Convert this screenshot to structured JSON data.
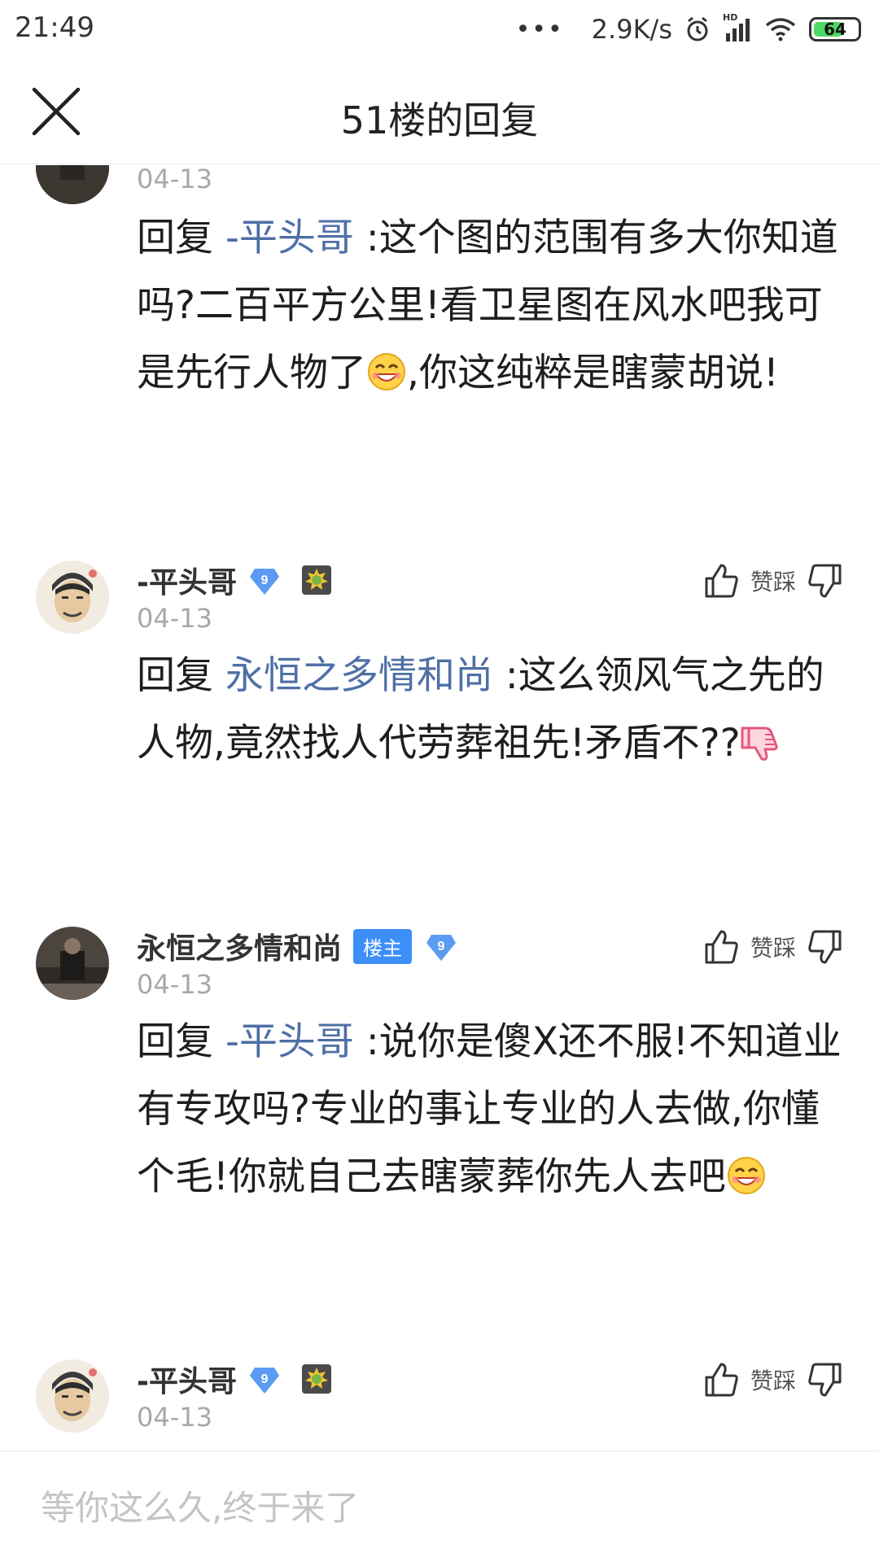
{
  "status_bar": {
    "time": "21:49",
    "dots": "•••",
    "speed": "2.9K/s",
    "hd_label": "HD",
    "battery": "64"
  },
  "header": {
    "title": "51楼的回复"
  },
  "replies": [
    {
      "username": "",
      "date": "04-13",
      "prefix": "回复",
      "mention": "-平头哥",
      "text": ":这个图的范围有多大你知道吗?二百平方公里!看卫星图在风水吧我可是先行人物了",
      "text_after": ",你这纯粹是瞎蒙胡说!",
      "emoji": "grin-emoji"
    },
    {
      "username": "-平头哥",
      "level": "9",
      "date": "04-13",
      "vote_label": "赞踩",
      "prefix": "回复",
      "mention": "永恒之多情和尚",
      "text": ":这么领风气之先的人物,竟然找人代劳葬祖先!矛盾不??",
      "emoji": "thumbs-down-emoji"
    },
    {
      "username": "永恒之多情和尚",
      "owner_badge": "楼主",
      "level": "9",
      "date": "04-13",
      "vote_label": "赞踩",
      "prefix": "回复",
      "mention": "-平头哥",
      "text": ":说你是傻X还不服!不知道业有专攻吗?专业的事让专业的人去做,你懂个毛!你就自己去瞎蒙葬你先人去吧",
      "emoji": "grin-emoji"
    },
    {
      "username": "-平头哥",
      "level": "9",
      "date": "04-13",
      "vote_label": "赞踩"
    }
  ],
  "input": {
    "placeholder": "等你这么久,终于来了"
  },
  "colors": {
    "mention": "#4f6fa6",
    "owner_badge": "#3d8ef7",
    "level_badge": "#5b9cf2",
    "date": "#a8a8a8"
  }
}
